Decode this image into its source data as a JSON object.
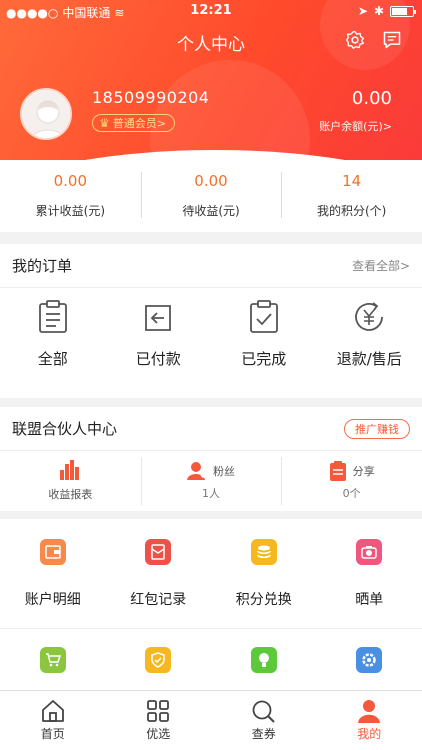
{
  "status_bar": {
    "carrier": "中国联通",
    "time": "12:21"
  },
  "header": {
    "title": "个人中心",
    "phone": "18509990204",
    "member_level": "普通会员>",
    "balance": "0.00",
    "balance_label": "账户余额(元)>"
  },
  "stats": [
    {
      "value": "0.00",
      "label": "累计收益(元)"
    },
    {
      "value": "0.00",
      "label": "待收益(元)"
    },
    {
      "value": "14",
      "label": "我的积分(个)"
    }
  ],
  "orders": {
    "title": "我的订单",
    "view_all": "查看全部>",
    "items": [
      {
        "label": "全部",
        "icon": "clipboard-icon"
      },
      {
        "label": "已付款",
        "icon": "return-icon"
      },
      {
        "label": "已完成",
        "icon": "checklist-icon"
      },
      {
        "label": "退款/售后",
        "icon": "yuan-refund-icon"
      }
    ]
  },
  "partner": {
    "title": "联盟合伙人中心",
    "promote": "推广赚钱",
    "items": [
      {
        "label": "收益报表",
        "sub": ""
      },
      {
        "label": "粉丝",
        "sub": "1人"
      },
      {
        "label": "分享",
        "sub": "0个"
      }
    ]
  },
  "services": [
    {
      "label": "账户明细",
      "icon": "account-detail-icon",
      "color": "#f78a4a"
    },
    {
      "label": "红包记录",
      "icon": "red-packet-icon",
      "color": "#f0504a"
    },
    {
      "label": "积分兑换",
      "icon": "coins-icon",
      "color": "#f5b820"
    },
    {
      "label": "晒单",
      "icon": "camera-icon",
      "color": "#f2557e"
    }
  ],
  "services2": [
    {
      "icon": "cart-icon",
      "color": "#8cc63f"
    },
    {
      "icon": "shield-check-icon",
      "color": "#f5b820"
    },
    {
      "icon": "bulb-icon",
      "color": "#5cc83a"
    },
    {
      "icon": "gear-icon",
      "color": "#4a90e2"
    }
  ],
  "tabbar": [
    {
      "label": "首页",
      "icon": "home-icon"
    },
    {
      "label": "优选",
      "icon": "grid-icon"
    },
    {
      "label": "查券",
      "icon": "search-icon"
    },
    {
      "label": "我的",
      "icon": "user-icon"
    }
  ],
  "colors": {
    "accent": "#f4593a",
    "header_start": "#ff6a3a",
    "header_end": "#fa3a3a"
  }
}
